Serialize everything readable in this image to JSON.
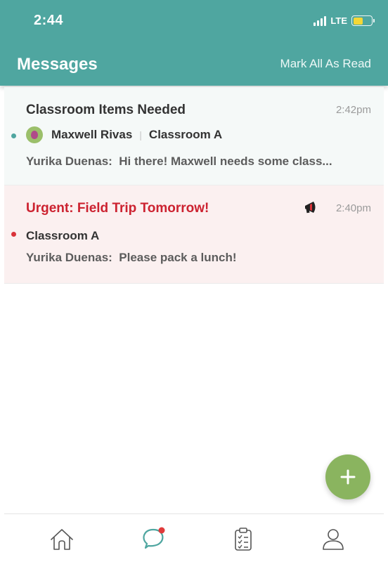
{
  "status_bar": {
    "time": "2:44",
    "network": "LTE",
    "battery_color": "#f5d736"
  },
  "header": {
    "title": "Messages",
    "mark_all_read": "Mark All As Read",
    "background": "#4fa6a0"
  },
  "messages": [
    {
      "title": "Classroom Items Needed",
      "time": "2:42pm",
      "unread_dot_color": "#4fa6a0",
      "avatar": "student-avatar",
      "student": "Maxwell Rivas",
      "classroom": "Classroom A",
      "sender": "Yurika Duenas:",
      "preview": "Hi there! Maxwell needs some class..."
    },
    {
      "title": "Urgent: Field Trip Tomorrow!",
      "time": "2:40pm",
      "urgent": true,
      "icon": "megaphone-icon",
      "unread_dot_color": "#d9333a",
      "classroom": "Classroom A",
      "sender": "Yurika Duenas:",
      "preview": "Please pack a lunch!"
    }
  ],
  "fab": {
    "icon": "plus-icon",
    "color": "#8ab45f"
  },
  "tabbar": {
    "items": [
      {
        "icon": "home-icon"
      },
      {
        "icon": "chat-icon",
        "active": true,
        "badge_color": "#e03a3a"
      },
      {
        "icon": "clipboard-icon"
      },
      {
        "icon": "profile-icon"
      }
    ]
  }
}
